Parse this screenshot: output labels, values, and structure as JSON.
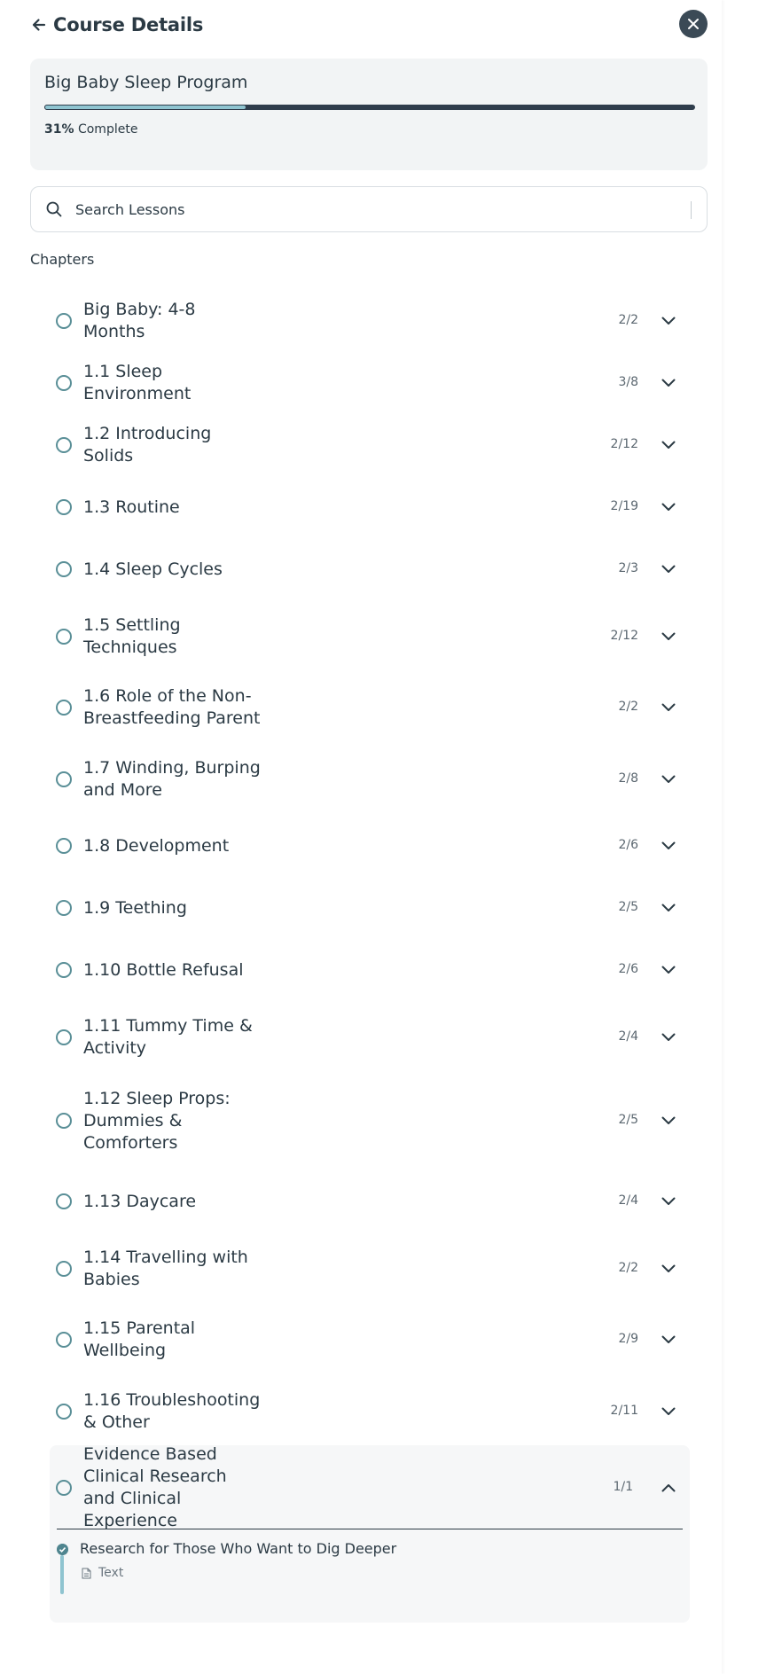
{
  "header": {
    "title": "Course Details"
  },
  "course": {
    "name": "Big Baby Sleep Program",
    "progress_value": "31",
    "progress_pct_sign": "%",
    "progress_suffix": "Complete",
    "progress_fraction": 0.31
  },
  "search": {
    "placeholder": "Search Lessons"
  },
  "chapters_label": "Chapters",
  "chapters": [
    {
      "title": "Big Baby: 4-8 Months",
      "count": "2/2"
    },
    {
      "title": "1.1 Sleep Environment",
      "count": "3/8"
    },
    {
      "title": "1.2 Introducing Solids",
      "count": "2/12"
    },
    {
      "title": "1.3 Routine",
      "count": "2/19"
    },
    {
      "title": "1.4 Sleep Cycles",
      "count": "2/3"
    },
    {
      "title": "1.5 Settling Techniques",
      "count": "2/12"
    },
    {
      "title": "1.6 Role of the Non-Breastfeeding Parent",
      "count": "2/2"
    },
    {
      "title": "1.7 Winding, Burping and More",
      "count": "2/8"
    },
    {
      "title": "1.8 Development",
      "count": "2/6"
    },
    {
      "title": "1.9 Teething",
      "count": "2/5"
    },
    {
      "title": "1.10 Bottle Refusal",
      "count": "2/6"
    },
    {
      "title": "1.11 Tummy Time & Activity",
      "count": "2/4"
    },
    {
      "title": "1.12 Sleep Props: Dummies & Comforters",
      "count": "2/5"
    },
    {
      "title": "1.13 Daycare",
      "count": "2/4"
    },
    {
      "title": "1.14 Travelling with Babies",
      "count": "2/2"
    },
    {
      "title": "1.15 Parental Wellbeing",
      "count": "2/9"
    },
    {
      "title": "1.16 Troubleshooting & Other",
      "count": "2/11"
    },
    {
      "title": "Evidence Based Clinical Research and Clinical Experience",
      "count": "1/1",
      "expanded": true,
      "lessons": [
        {
          "title": "Research for Those Who Want to Dig Deeper",
          "type": "Text",
          "completed": true
        }
      ]
    }
  ],
  "colors": {
    "accent": "#8fc4d0",
    "circle": "#5a8f97",
    "dark": "#2f3d4c"
  },
  "icons": {
    "back": "arrow-left-icon",
    "close": "close-icon",
    "search": "search-icon",
    "chevron_down": "chevron-down-icon",
    "chevron_up": "chevron-up-icon",
    "check": "check-circle-icon",
    "doc": "document-icon"
  }
}
